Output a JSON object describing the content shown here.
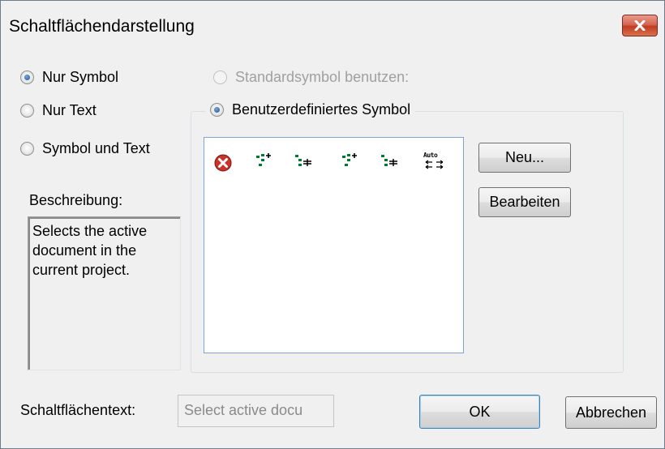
{
  "window": {
    "title": "Schaltflächendarstellung"
  },
  "display_mode": {
    "options": [
      "Nur Symbol",
      "Nur Text",
      "Symbol und Text"
    ],
    "selected": "Nur Symbol"
  },
  "symbol_source": {
    "standard_label": "Standardsymbol benutzen:",
    "custom_label": "Benutzerdefiniertes Symbol"
  },
  "icons": [
    "close-red-icon",
    "split-add-icon",
    "split-insert-icon",
    "split-add-icon",
    "split-insert-icon"
  ],
  "icon_auto_text": "Auto",
  "buttons": {
    "new": "Neu...",
    "edit": "Bearbeiten",
    "ok": "OK",
    "cancel": "Abbrechen"
  },
  "description": {
    "label": "Beschreibung:",
    "text": "Selects the active document in the current project."
  },
  "button_text": {
    "label": "Schaltflächentext:",
    "value": "Select active docu"
  },
  "colors": {
    "accent_green": "#007a2e",
    "close_red": "#c9332a",
    "selection_border": "#7aa6d6"
  }
}
